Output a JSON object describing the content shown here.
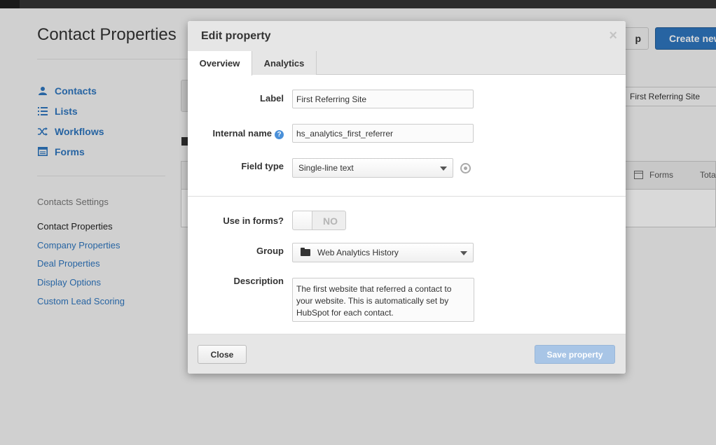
{
  "page": {
    "title": "Contact Properties",
    "btn_setup_partial": "p",
    "btn_create_partial": "Create new",
    "filter_value": "First Referring Site",
    "table_col_forms": "Forms",
    "table_col_total": "Tota"
  },
  "nav": {
    "items": [
      {
        "label": "Contacts",
        "icon": "person-icon"
      },
      {
        "label": "Lists",
        "icon": "list-icon"
      },
      {
        "label": "Workflows",
        "icon": "shuffle-icon"
      },
      {
        "label": "Forms",
        "icon": "form-icon"
      }
    ]
  },
  "settings": {
    "heading": "Contacts Settings",
    "items": [
      "Contact Properties",
      "Company Properties",
      "Deal Properties",
      "Display Options",
      "Custom Lead Scoring"
    ]
  },
  "modal": {
    "title": "Edit property",
    "close_glyph": "×",
    "tabs": [
      "Overview",
      "Analytics"
    ],
    "label_label": "Label",
    "label_value": "First Referring Site",
    "internal_name_label": "Internal name",
    "help_glyph": "?",
    "internal_name_value": "hs_analytics_first_referrer",
    "field_type_label": "Field type",
    "field_type_value": "Single-line text",
    "use_in_forms_label": "Use in forms?",
    "use_in_forms_value": "NO",
    "group_label": "Group",
    "group_value": "Web Analytics History",
    "description_label": "Description",
    "description_value": "The first website that referred a contact to your website. This is automatically set by HubSpot for each contact.",
    "close_button": "Close",
    "save_button": "Save property"
  },
  "colors": {
    "link": "#2e76bf",
    "save_disabled": "#a8c5e6"
  }
}
